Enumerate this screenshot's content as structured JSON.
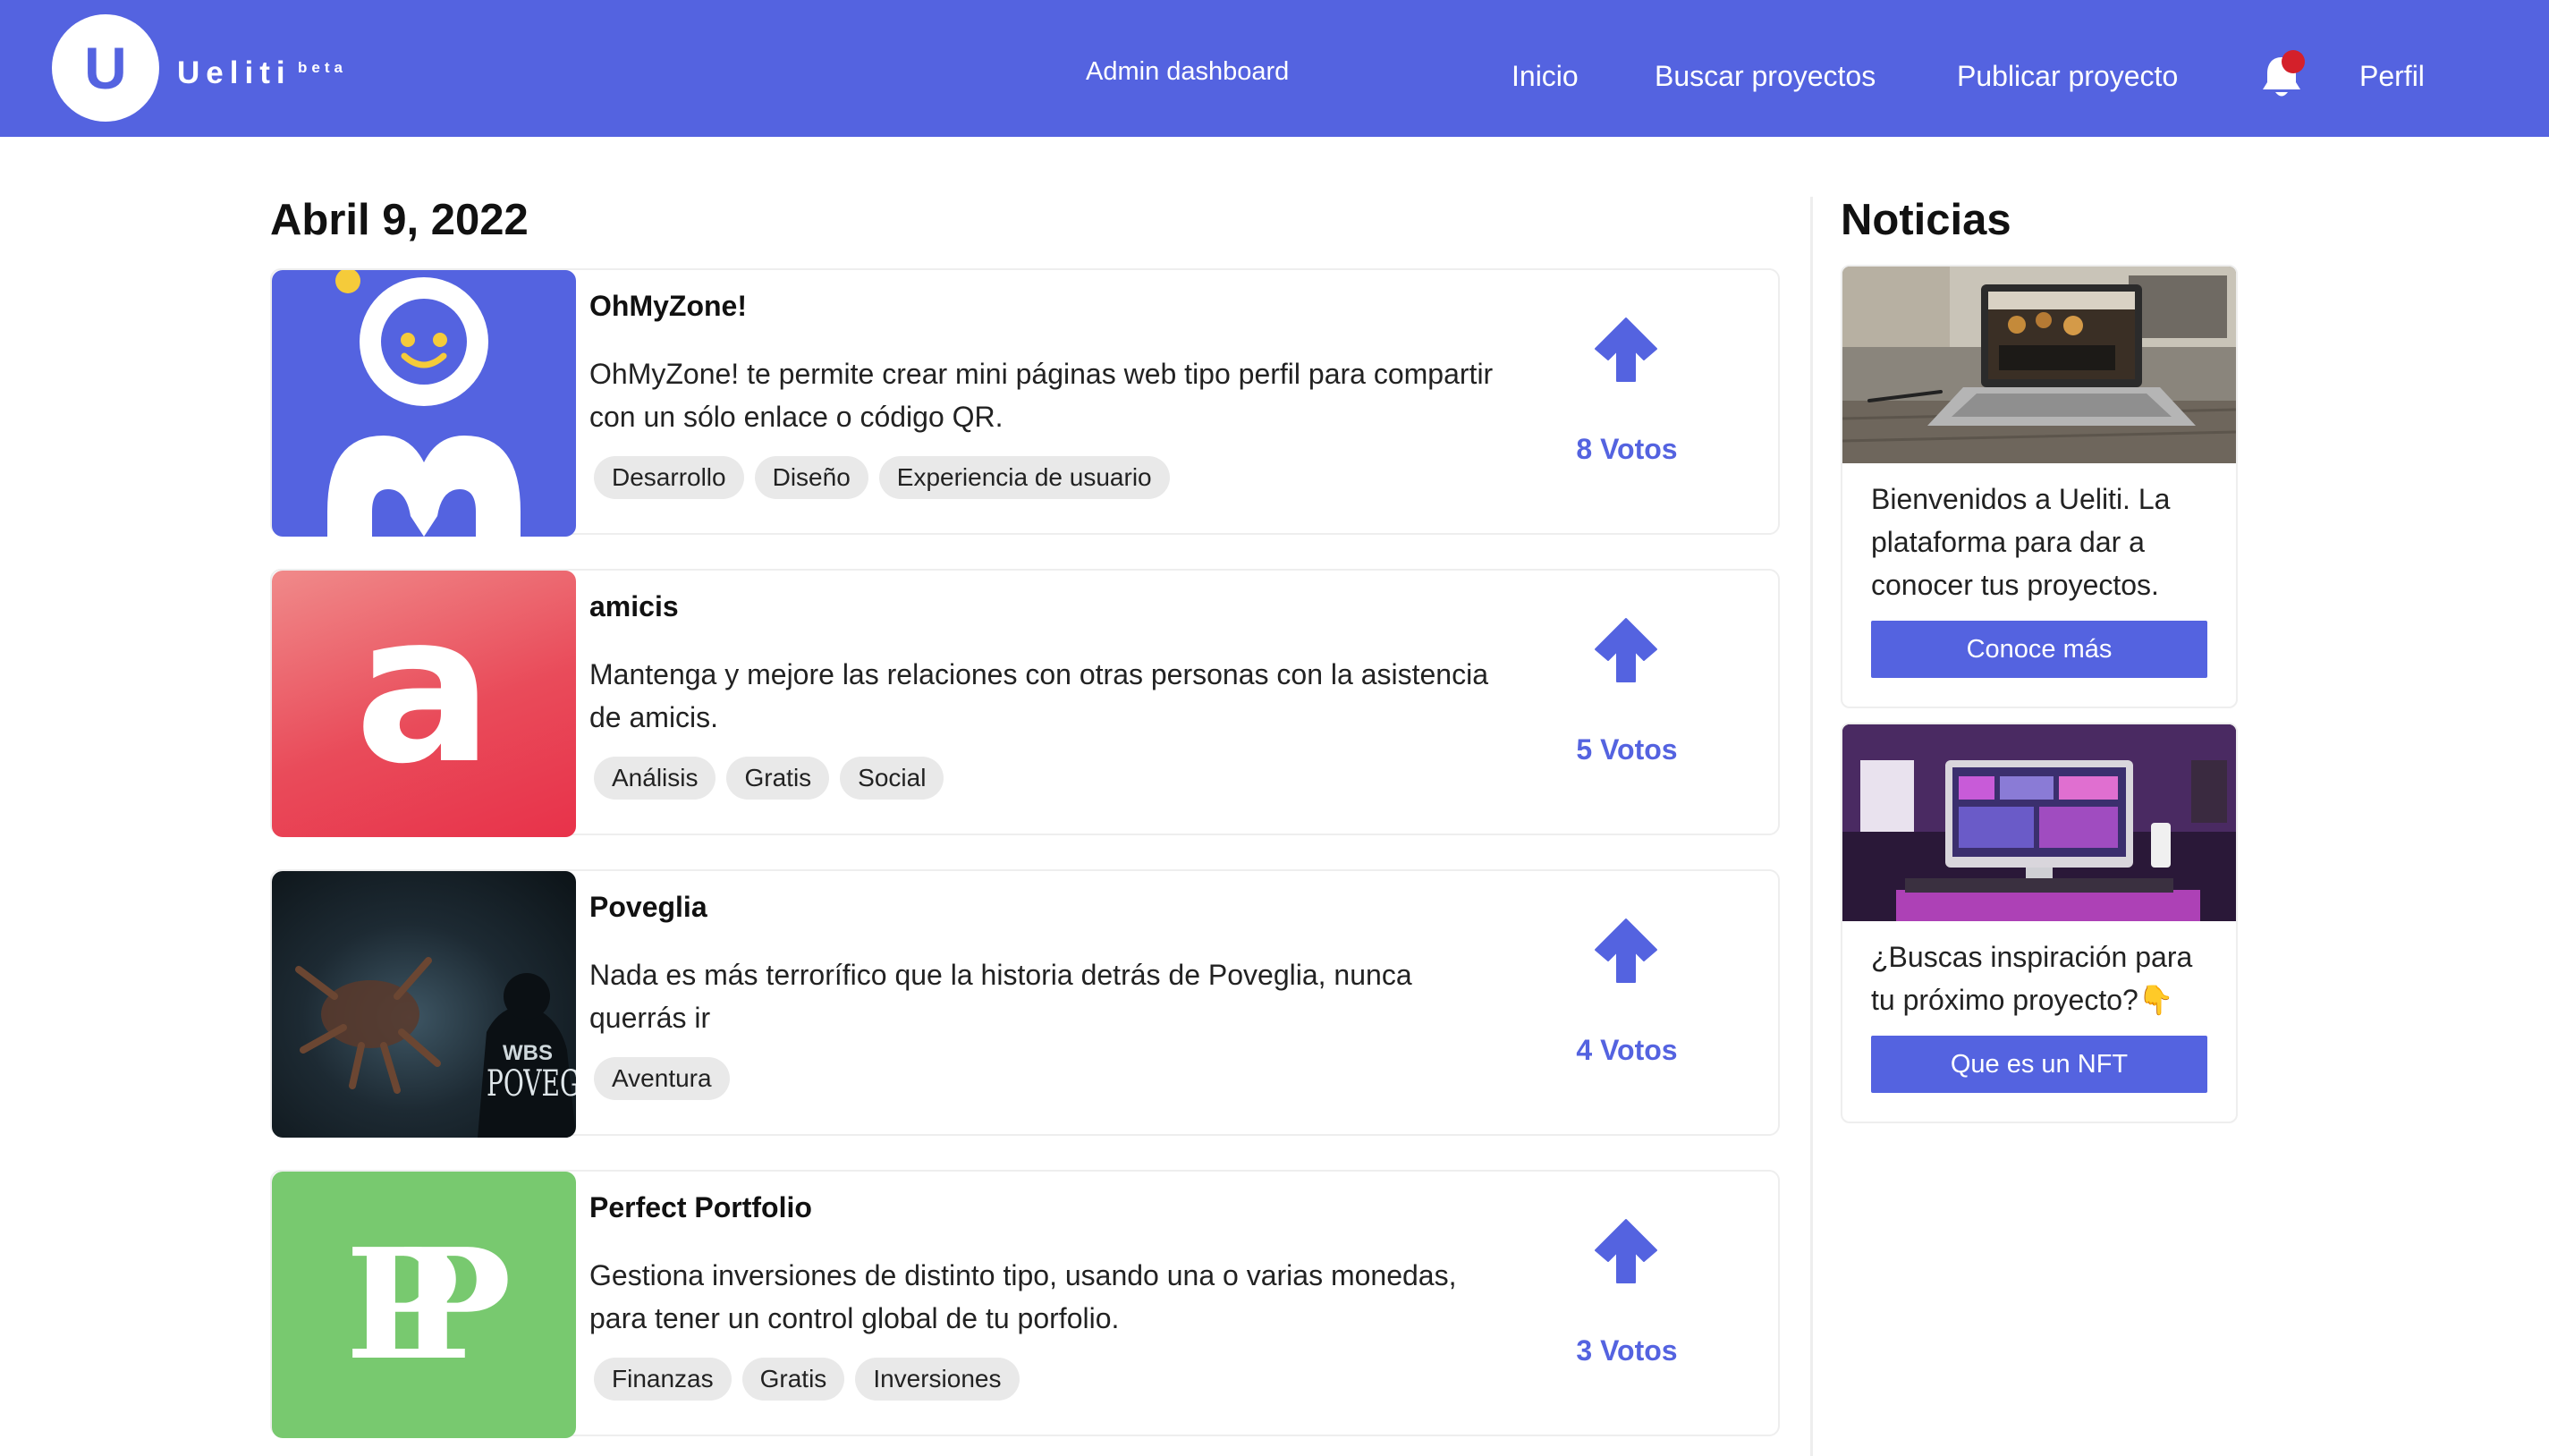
{
  "brand": {
    "logo_letter": "U",
    "name": "Ueliti",
    "badge": "beta"
  },
  "nav": {
    "admin": "Admin dashboard",
    "inicio": "Inicio",
    "buscar": "Buscar proyectos",
    "publicar": "Publicar proyecto",
    "perfil": "Perfil",
    "bell_icon": "bell-icon",
    "notification_dot_color": "#d4202a"
  },
  "feed": {
    "date": "Abril 9, 2022",
    "projects": [
      {
        "title": "OhMyZone!",
        "description": "OhMyZone! te permite crear mini páginas web tipo perfil para compartir con un sólo enlace o código QR.",
        "tags": [
          "Desarrollo",
          "Diseño",
          "Experiencia de usuario"
        ],
        "votes": "8 Votos"
      },
      {
        "title": "amicis",
        "description": "Mantenga y mejore las relaciones con otras personas con la asistencia de amicis.",
        "tags": [
          "Análisis",
          "Gratis",
          "Social"
        ],
        "votes": "5 Votos",
        "logo_letter": "a"
      },
      {
        "title": "Poveglia",
        "description": "Nada es más terrorífico que la historia detrás de Poveglia, nunca querrás ir",
        "tags": [
          "Aventura"
        ],
        "votes": "4 Votos",
        "thumb_text_1": "WBS",
        "thumb_text_2": "POVEGLI"
      },
      {
        "title": "Perfect Portfolio",
        "description": "Gestiona inversiones de distinto tipo, usando una o varias monedas, para tener un control global de tu porfolio.",
        "tags": [
          "Finanzas",
          "Gratis",
          "Inversiones"
        ],
        "votes": "3 Votos",
        "logo_letters": "PP"
      }
    ]
  },
  "news": {
    "heading": "Noticias",
    "items": [
      {
        "text": "Bienvenidos a Ueliti. La plataforma para dar a conocer tus proyectos.",
        "button": "Conoce más"
      },
      {
        "text": "¿Buscas inspiración para tu próximo proyecto?👇",
        "button": "Que es un NFT"
      }
    ]
  },
  "colors": {
    "accent": "#5463e0",
    "tag_bg": "#e9e9e9"
  }
}
